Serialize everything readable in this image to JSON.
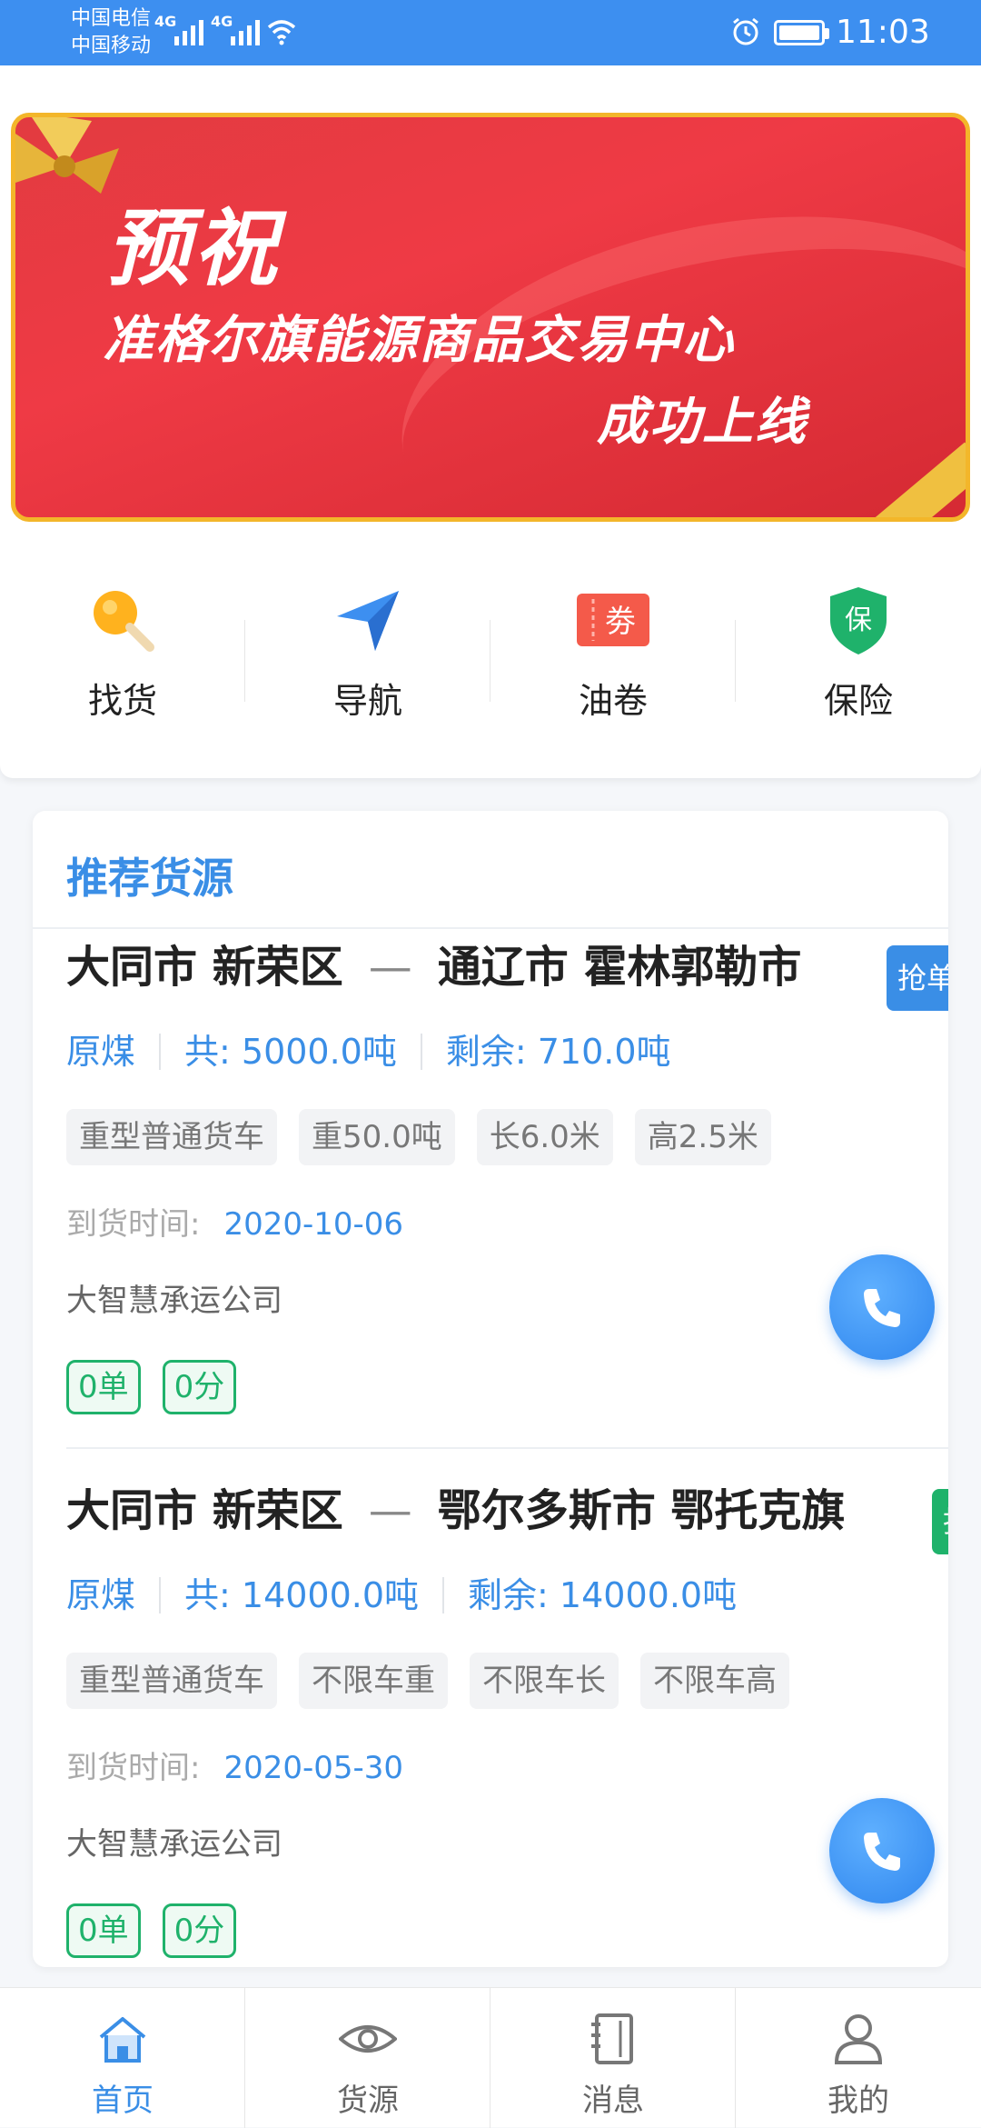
{
  "status_bar": {
    "carrier1": "中国电信",
    "carrier2": "中国移动",
    "net1": "4G",
    "net2": "4G",
    "time": "11:03"
  },
  "banner": {
    "line1": "预祝",
    "line2": "准格尔旗能源商品交易中心",
    "line3": "成功上线"
  },
  "quick_actions": [
    {
      "label": "找货",
      "icon": "magnifier-icon"
    },
    {
      "label": "导航",
      "icon": "navigation-arrow-icon"
    },
    {
      "label": "油卷",
      "icon": "coupon-icon",
      "icon_text": "劵"
    },
    {
      "label": "保险",
      "icon": "insurance-shield-icon",
      "icon_text": "保"
    }
  ],
  "section_title": "推荐货源",
  "cargo": [
    {
      "from": "大同市 新荣区",
      "dash": "—",
      "to": "通辽市 霍林郭勒市",
      "grab": "抢单",
      "goods": "原煤",
      "total": "共: 5000.0吨",
      "remain": "剩余: 710.0吨",
      "tags": [
        "重型普通货车",
        "重50.0吨",
        "长6.0米",
        "高2.5米"
      ],
      "arrival_label": "到货时间:",
      "arrival_date": "2020-10-06",
      "company": "大智慧承运公司",
      "orders": "0单",
      "score": "0分"
    },
    {
      "from": "大同市 新荣区",
      "dash": "—",
      "to": "鄂尔多斯市 鄂托克旗",
      "grab": "抢单",
      "goods": "原煤",
      "total": "共: 14000.0吨",
      "remain": "剩余: 14000.0吨",
      "tags": [
        "重型普通货车",
        "不限车重",
        "不限车长",
        "不限车高"
      ],
      "arrival_label": "到货时间:",
      "arrival_date": "2020-05-30",
      "company": "大智慧承运公司",
      "orders": "0单",
      "score": "0分"
    }
  ],
  "tabbar": [
    {
      "label": "首页",
      "icon": "home-icon",
      "active": true
    },
    {
      "label": "货源",
      "icon": "eye-icon",
      "active": false
    },
    {
      "label": "消息",
      "icon": "notebook-icon",
      "active": false
    },
    {
      "label": "我的",
      "icon": "user-icon",
      "active": false
    }
  ],
  "colors": {
    "primary": "#3a8ee6",
    "status_bar": "#3d8ff0",
    "banner_red": "#e23b40",
    "banner_gold": "#f3b62a",
    "green": "#1fb26b"
  }
}
